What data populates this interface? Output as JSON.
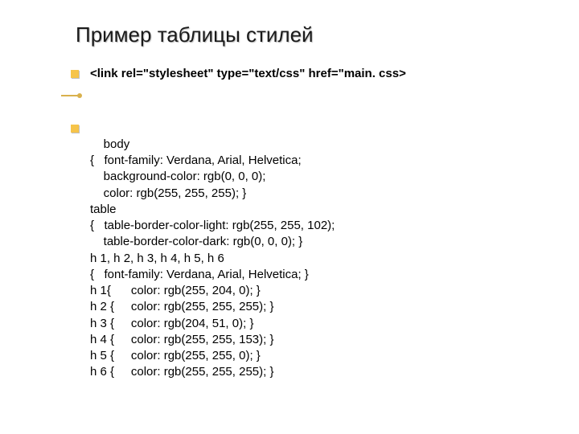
{
  "title": "Пример таблицы стилей",
  "link_line": "<link rel=\"stylesheet\" type=\"text/css\" href=\"main. css>",
  "code": "body\n{   font-family: Verdana, Arial, Helvetica;\n    background-color: rgb(0, 0, 0);\n    color: rgb(255, 255, 255); }\ntable\n{   table-border-color-light: rgb(255, 255, 102);\n    table-border-color-dark: rgb(0, 0, 0); }\nh 1, h 2, h 3, h 4, h 5, h 6\n{   font-family: Verdana, Arial, Helvetica; }\nh 1{      color: rgb(255, 204, 0); }\nh 2 {     color: rgb(255, 255, 255); }\nh 3 {     color: rgb(204, 51, 0); }\nh 4 {     color: rgb(255, 255, 153); }\nh 5 {     color: rgb(255, 255, 0); }\nh 6 {     color: rgb(255, 255, 255); }"
}
